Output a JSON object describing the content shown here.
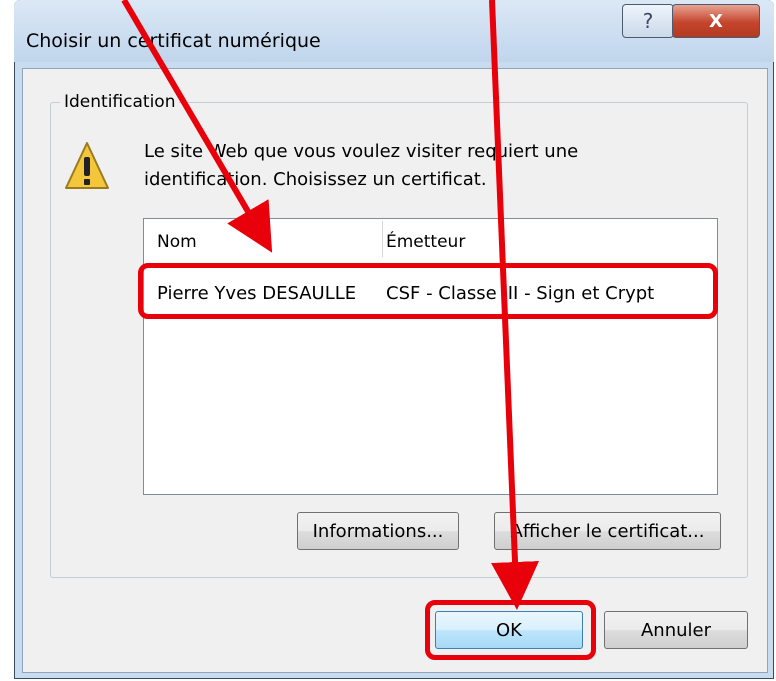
{
  "dialog": {
    "title": "Choisir un certificat numérique",
    "help_glyph": "?",
    "close_glyph": "X",
    "group_label": "Identification",
    "message": "Le site Web que vous voulez visiter requiert une identification. Choisissez un certificat.",
    "warning_icon": "warning-icon"
  },
  "certificates": {
    "columns": [
      "Nom",
      "Émetteur"
    ],
    "rows": [
      {
        "nom": "Pierre Yves DESAULLE",
        "emetteur": "CSF - Classe III - Sign et Crypt"
      }
    ]
  },
  "buttons": {
    "informations": "Informations...",
    "afficher": "Afficher le certificat...",
    "ok": "OK",
    "annuler": "Annuler"
  },
  "annotation": {
    "color": "#e8000b"
  }
}
